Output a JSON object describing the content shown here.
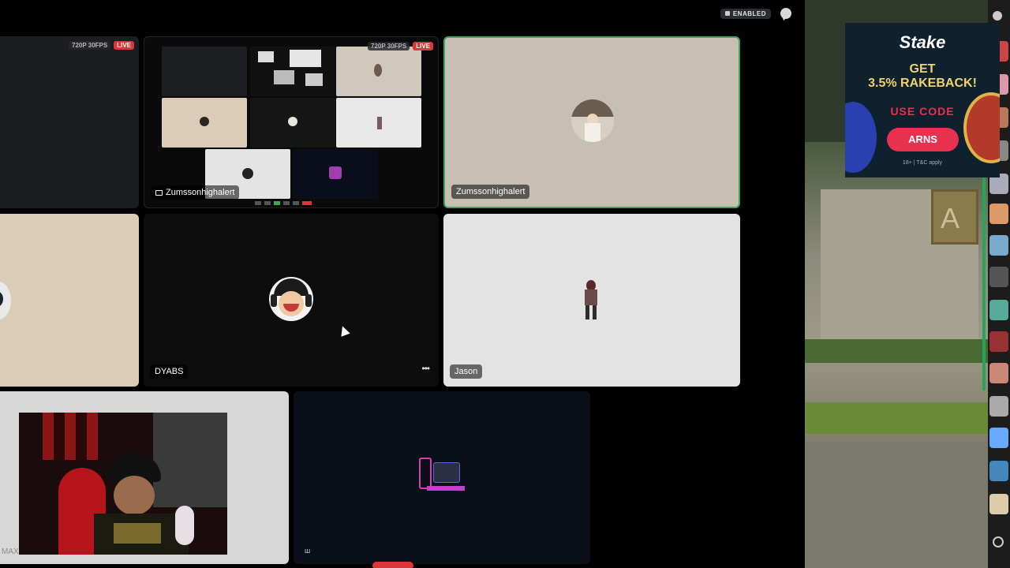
{
  "header": {
    "enabled_label": "ENABLED"
  },
  "tiles": {
    "stream1": {
      "quality": "720P 30FPS",
      "live": "LIVE"
    },
    "stream2": {
      "quality": "720P 30FPS",
      "live": "LIVE",
      "name": "Zumssonhighalert"
    },
    "user_zumsson": {
      "name": "Zumssonhighalert"
    },
    "user_dyabs": {
      "name": "DYABS"
    },
    "user_jason": {
      "name": "Jason"
    },
    "webcam": {
      "name": "MAX"
    }
  },
  "ad": {
    "brand": "Stake",
    "line1": "GET",
    "line2": "3.5% RAKEBACK!",
    "line3": "USE CODE",
    "code": "ARNS",
    "fine_print": "18+ | T&C apply"
  },
  "game": {
    "sign_letter": "A"
  },
  "colors": {
    "speaking_border": "#3ba55c",
    "live_red": "#da373c",
    "ad_bg": "#0f212e",
    "ad_button": "#e8304f",
    "ad_text": "#f0d36a"
  }
}
